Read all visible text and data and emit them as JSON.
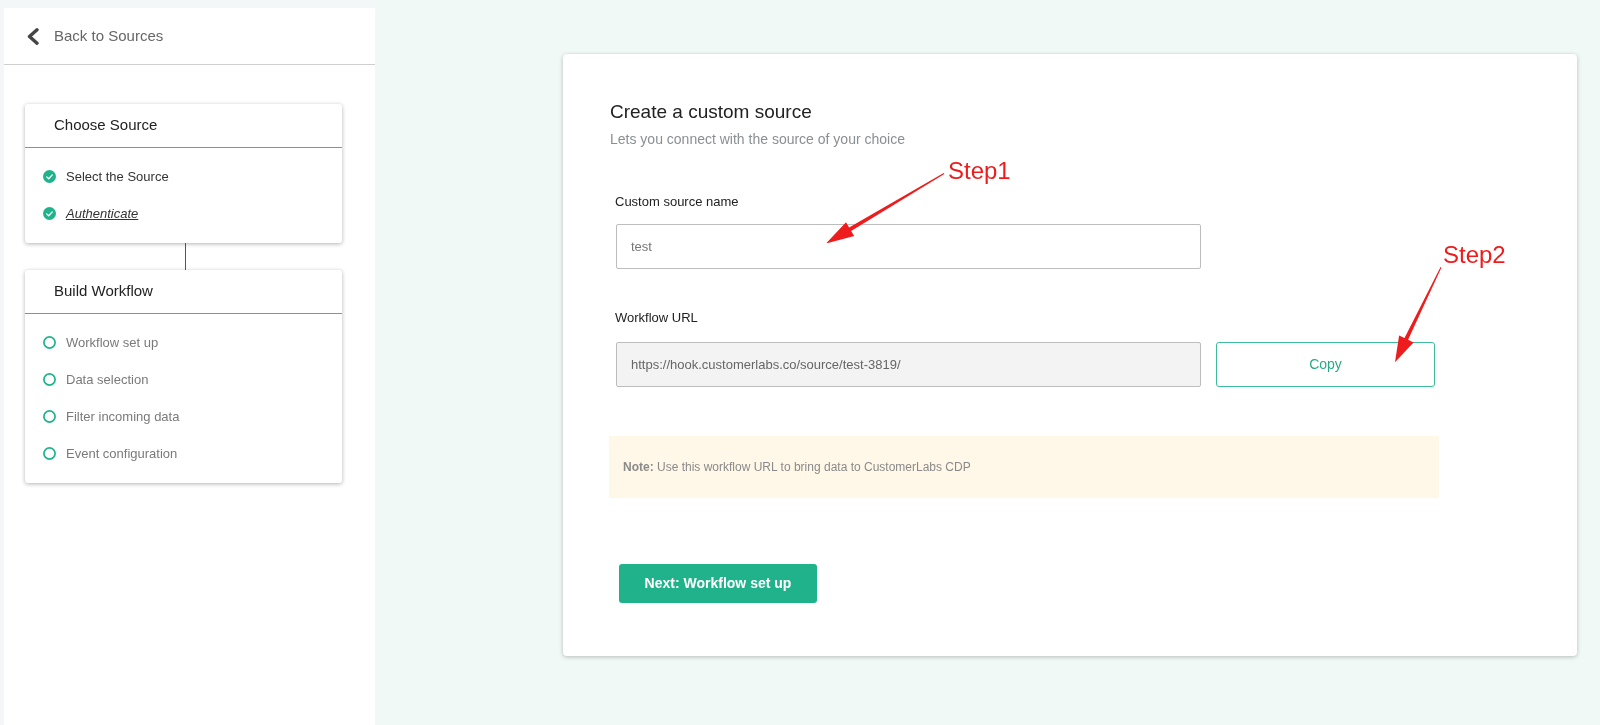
{
  "sidebar": {
    "back_link": {
      "label": "Back to Sources"
    },
    "groups": [
      {
        "title": "Choose Source",
        "steps": [
          {
            "label": "Select the Source",
            "done": true,
            "selected": false
          },
          {
            "label": "Authenticate",
            "done": true,
            "selected": true
          }
        ]
      },
      {
        "title": "Build Workflow",
        "steps": [
          {
            "label": "Workflow set up",
            "done": false,
            "selected": false
          },
          {
            "label": "Data selection",
            "done": false,
            "selected": false
          },
          {
            "label": "Filter incoming data",
            "done": false,
            "selected": false
          },
          {
            "label": "Event configuration",
            "done": false,
            "selected": false
          }
        ]
      }
    ]
  },
  "form": {
    "title": "Create a custom source",
    "subtitle": "Lets you connect with the source of your choice",
    "fields": [
      {
        "kind": "text",
        "label": "Custom source name",
        "value": "test"
      },
      {
        "kind": "readonly",
        "label": "Workflow URL",
        "value": "https://hook.customerlabs.co/source/test-3819/",
        "action": "Copy"
      }
    ],
    "note": "**Note:** Use this workflow URL to bring data to CustomerLabs CDP",
    "next_button": "Next: Workflow set up"
  },
  "annotations": [
    {
      "text": "Step1"
    },
    {
      "text": "Step2"
    }
  ]
}
